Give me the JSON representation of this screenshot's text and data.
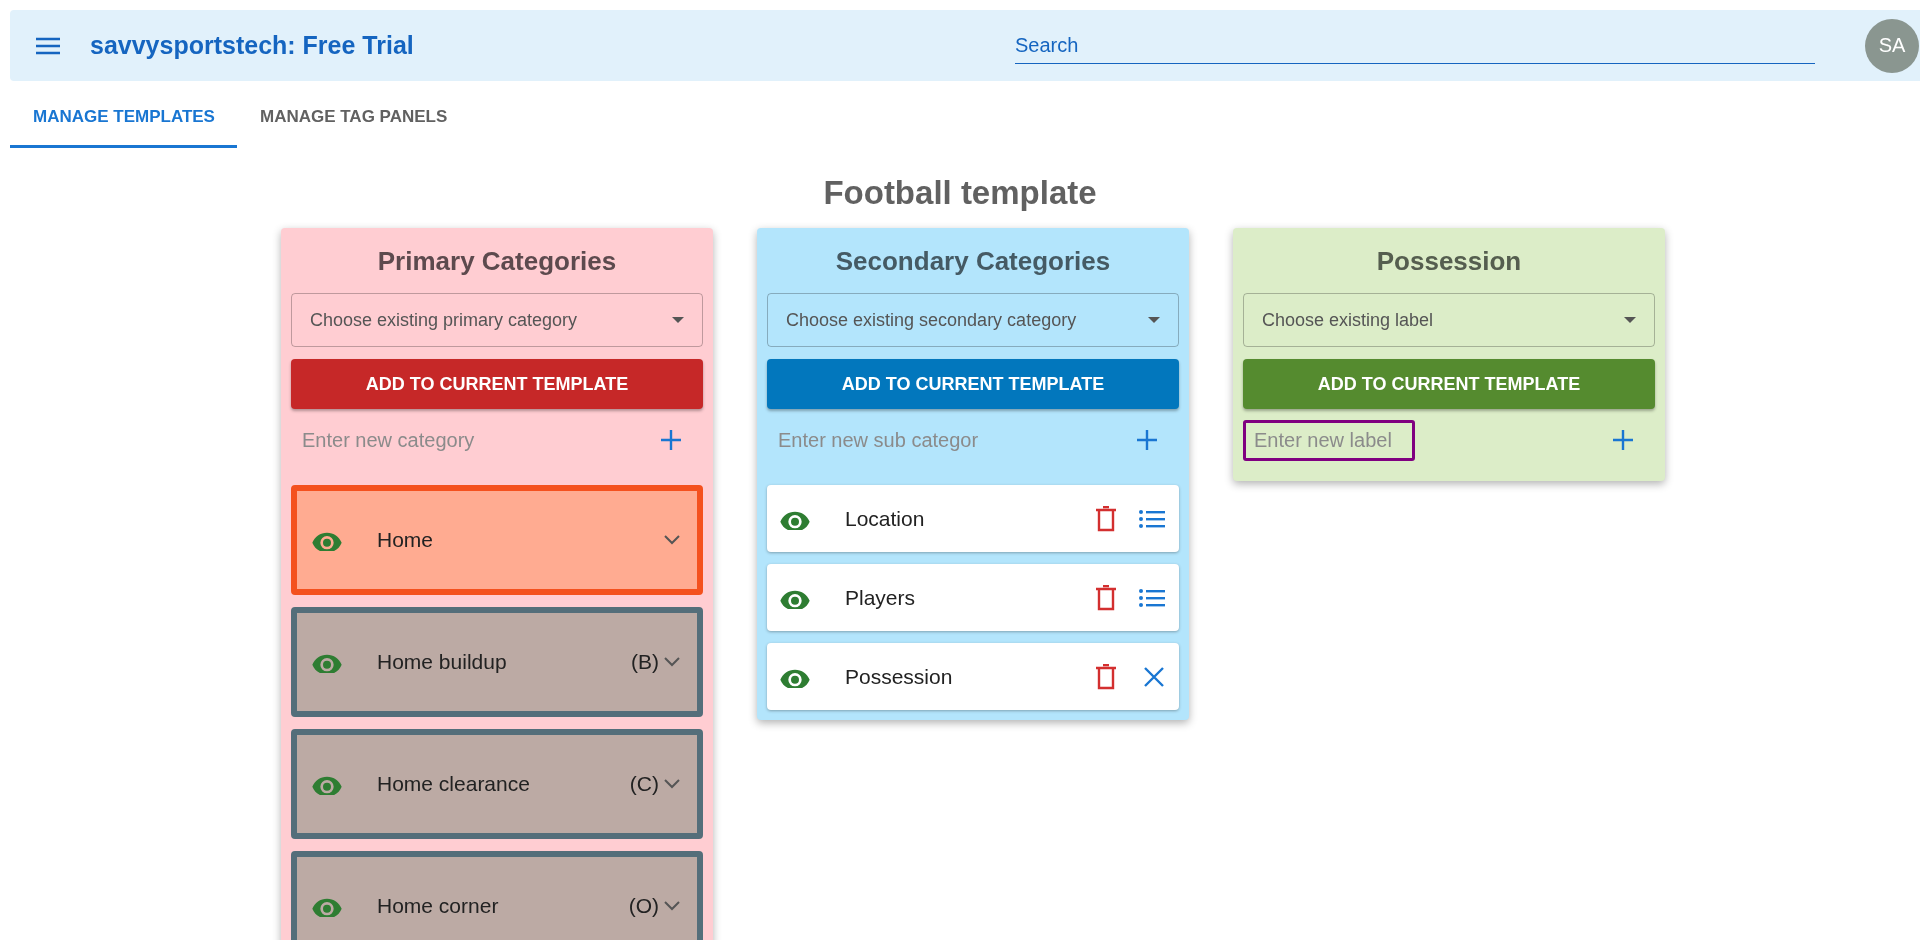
{
  "app_bar": {
    "title": "savvysportstech: Free Trial",
    "search": {
      "placeholder": "Search"
    },
    "avatar": "SA"
  },
  "tabs": [
    {
      "label": "MANAGE TEMPLATES",
      "selected": true
    },
    {
      "label": "MANAGE TAG PANELS",
      "selected": false
    }
  ],
  "page_title": "Football template",
  "panels": [
    {
      "kind": "primary",
      "title": "Primary Categories",
      "select_placeholder": "Choose existing primary category",
      "button": "ADD TO CURRENT TEMPLATE",
      "input": {
        "placeholder": "Enter new category",
        "focused": false
      },
      "items": [
        {
          "label": "Home",
          "selected": true
        },
        {
          "label": "Home buildup",
          "hotkey": "(B)",
          "selected": false
        },
        {
          "label": "Home clearance",
          "hotkey": "(C)",
          "selected": false
        },
        {
          "label": "Home corner",
          "hotkey": "(O)",
          "selected": false
        }
      ]
    },
    {
      "kind": "secondary",
      "title": "Secondary Categories",
      "select_placeholder": "Choose existing secondary category",
      "button": "ADD TO CURRENT TEMPLATE",
      "input": {
        "placeholder": "Enter new sub categor",
        "focused": false
      },
      "items": [
        {
          "label": "Location",
          "expanded": false
        },
        {
          "label": "Players",
          "expanded": false
        },
        {
          "label": "Possession",
          "expanded": true
        }
      ]
    },
    {
      "kind": "label",
      "title": "Possession",
      "select_placeholder": "Choose existing label",
      "button": "ADD TO CURRENT TEMPLATE",
      "input": {
        "placeholder": "Enter new label",
        "focused": true
      }
    }
  ]
}
